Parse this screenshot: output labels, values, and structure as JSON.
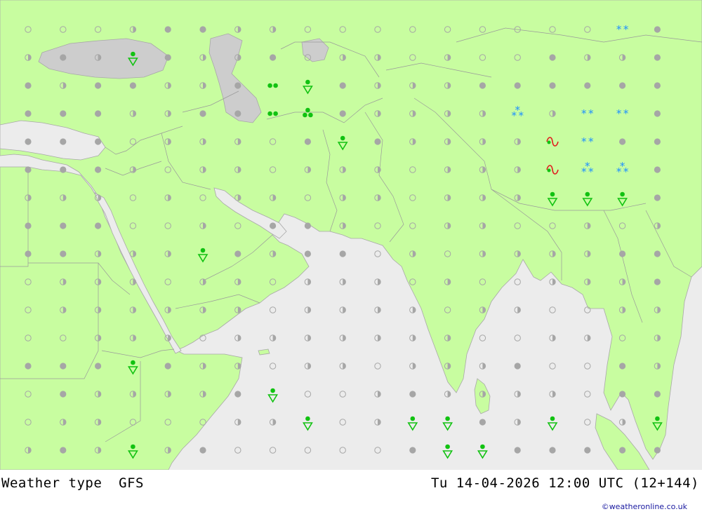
{
  "title": {
    "product": "Weather type",
    "model": "GFS",
    "valid_time": "Tu 14-04-2026 12:00 UTC (12+144)"
  },
  "credit": "©weatheronline.co.uk",
  "colors": {
    "land": "#c8fda0",
    "sea": "#ececec",
    "border": "#a0a0a0",
    "inland_water": "#cdcdcd",
    "dot_fill": "#a6a6a6",
    "dot_stroke": "#a6a6a6",
    "rain_green": "#11c211",
    "snow_blue": "#1e90ff",
    "mixed_red": "#e02020"
  },
  "grid": {
    "lon_points": 19,
    "lat_points": 16
  },
  "symbols": {
    "legend_note": "o=clear, h=partly cloudy, f=overcast, R=rain shower, D=drizzle, T=showers/triangle, S=snow, W=snow shower, M=mixed",
    "rows": [
      "ooohf fhhoooooooooSf",
      "hfhTfhhfohhohoofhhf",
      "fhffhhfDTfhhhffffff",
      "fffhhffDRfhhhhWhSSf",
      "fffohhhofTfhhhhMSff",
      "fffhohhohhhohhhMWWf",
      "hhhohohhohhohhhTTTf",
      "fffoohoffhoohhoohoh",
      "ffhhhTfhffohohhhhff",
      "ohhhohhohhhohoohhhf",
      "ohhhhhhohhhhohhoohh",
      "oohhhohhhhhhhoohhoh",
      "fffTfhhohhohhhfoofh",
      "ofhhhhfToohfhhhhoff",
      "ohhooohhTohTTfhTohT",
      "hfhThfooooofTTfffff"
    ]
  }
}
